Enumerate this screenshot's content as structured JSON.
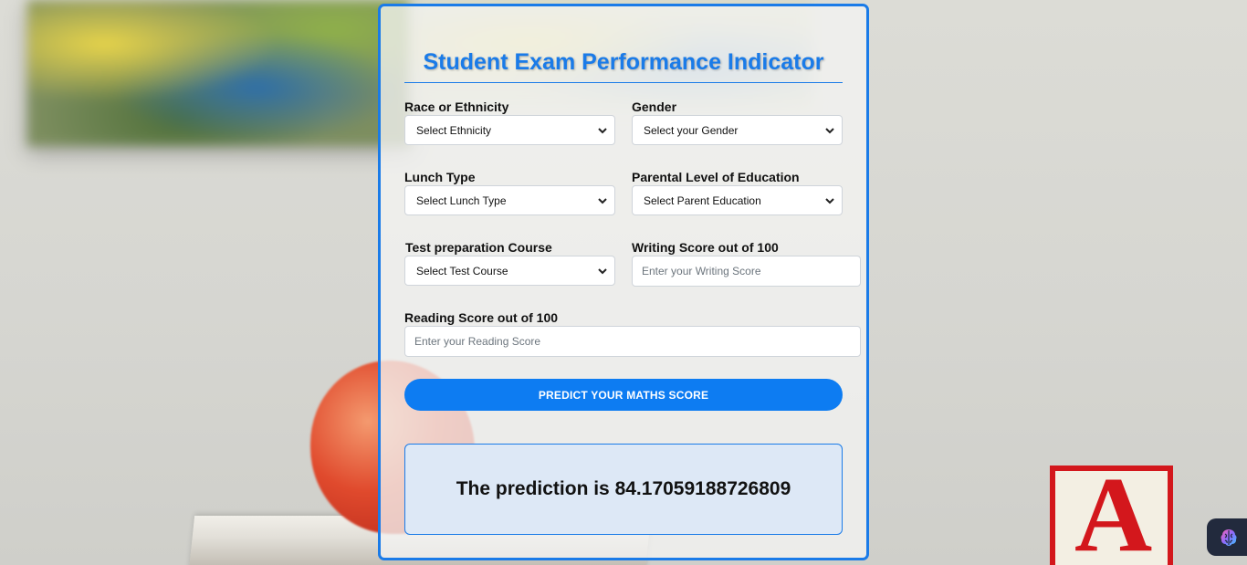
{
  "page": {
    "title": "Student Exam Performance Indicator"
  },
  "form": {
    "ethnicity": {
      "label": "Race or Ethnicity",
      "selected": "Select Ethnicity"
    },
    "gender": {
      "label": "Gender",
      "selected": "Select your Gender"
    },
    "lunch": {
      "label": "Lunch Type",
      "selected": "Select Lunch Type"
    },
    "parent_education": {
      "label": "Parental Level of Education",
      "selected": "Select Parent Education"
    },
    "test_course": {
      "label": "Test preparation Course",
      "selected": "Select Test Course"
    },
    "writing_score": {
      "label": "Writing Score out of 100",
      "placeholder": "Enter your Writing Score"
    },
    "reading_score": {
      "label": "Reading Score out of 100",
      "placeholder": "Enter your Reading Score"
    },
    "submit_label": "PREDICT YOUR MATHS SCORE"
  },
  "result": {
    "text": "The prediction is 84.17059188726809"
  },
  "colors": {
    "accent": "#1a7be8",
    "button": "#0d7cf2",
    "result_bg": "#dde8f6"
  },
  "icons": {
    "select_arrow": "chevron-down-icon",
    "extension": "brain-icon"
  }
}
